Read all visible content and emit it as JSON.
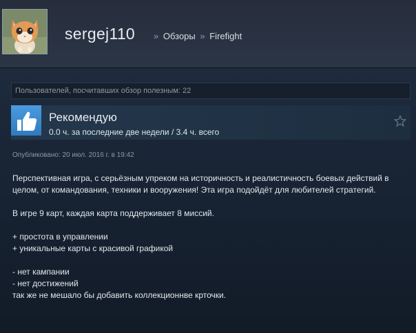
{
  "header": {
    "persona_name": "sergej110",
    "breadcrumb": {
      "separator": "»",
      "items": [
        "Обзоры",
        "Firefight"
      ]
    }
  },
  "review": {
    "helpful_text": "Пользователей, посчитавших обзор полезным: 22",
    "recommendation": "Рекомендую",
    "hours": "0.0 ч. за последние две недели / 3.4 ч. всего",
    "posted": "Опубликовано: 20 июл. 2016 г. в 19:42",
    "body": {
      "para1": "Перспективная игра, с серьёзным упреком на историчность и реалистичность боевых действий в целом, от командования, техники и вооружения! Эта игра подойдёт для любителей стратегий.",
      "para2": "В игре 9 карт, каждая карта поддерживает 8 миссий.",
      "pro1": "+ простота в управлении",
      "pro2": "+ уникальные карты с красивой графикой",
      "con1": "- нет кампании",
      "con2": "- нет достижений",
      "con3": "так же не мешало бы добавить коллекционнве крточки."
    }
  },
  "icons": {
    "thumb": "thumbs-up-icon",
    "favorite": "star-icon"
  },
  "colors": {
    "background": "#1b2838",
    "thumb_blue": "#4b9be0"
  }
}
